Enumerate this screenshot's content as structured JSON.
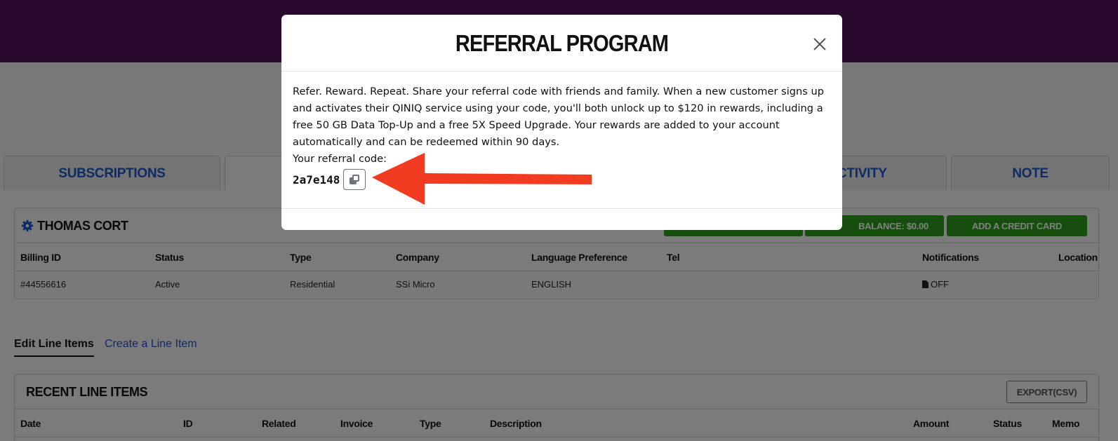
{
  "tabs": [
    {
      "label": "SUBSCRIPTIONS"
    },
    {
      "label": ""
    },
    {
      "label": "CTIVITY"
    },
    {
      "label": "NOTE"
    }
  ],
  "customer_panel": {
    "name": "THOMAS CORT",
    "balance_button": "BALANCE: $0.00",
    "add_card_button": "ADD A CREDIT CARD",
    "columns": [
      "Billing ID",
      "Status",
      "Type",
      "Company",
      "Language Preference",
      "Tel",
      "Notifications",
      "Location"
    ],
    "row": {
      "billing_id": "#44556616",
      "status": "Active",
      "type": "Residential",
      "company": "SSi Micro",
      "language": "ENGLISH",
      "tel": "",
      "notifications": "OFF",
      "location": ""
    }
  },
  "line_item_tabs": {
    "edit": "Edit Line Items",
    "create": "Create a Line Item"
  },
  "recent_panel": {
    "title": "RECENT LINE ITEMS",
    "export_button": "EXPORT(CSV)",
    "columns": [
      "Date",
      "ID",
      "Related",
      "Invoice",
      "Type",
      "Description",
      "Amount",
      "Status",
      "Memo"
    ]
  },
  "modal": {
    "title": "REFERRAL PROGRAM",
    "description": "Refer. Reward. Repeat. Share your referral code with friends and family. When a new customer signs up and activates their QINIQ service using your code, you'll both unlock up to $120 in rewards, including a free 50 GB Data Top-Up and a free 5X Speed Upgrade. Your rewards are added to your account automatically and can be redeemed within 90 days.",
    "code_label": "Your referral code:",
    "code_value": "2a7e148"
  },
  "colors": {
    "topbar": "#54125f",
    "accent_blue": "#1a56c9",
    "button_green": "#2c9e1a",
    "annotation_arrow": "#f23c22"
  },
  "icons": [
    "gear-icon",
    "document-icon",
    "close-icon",
    "copy-icon",
    "annotation-arrow"
  ]
}
